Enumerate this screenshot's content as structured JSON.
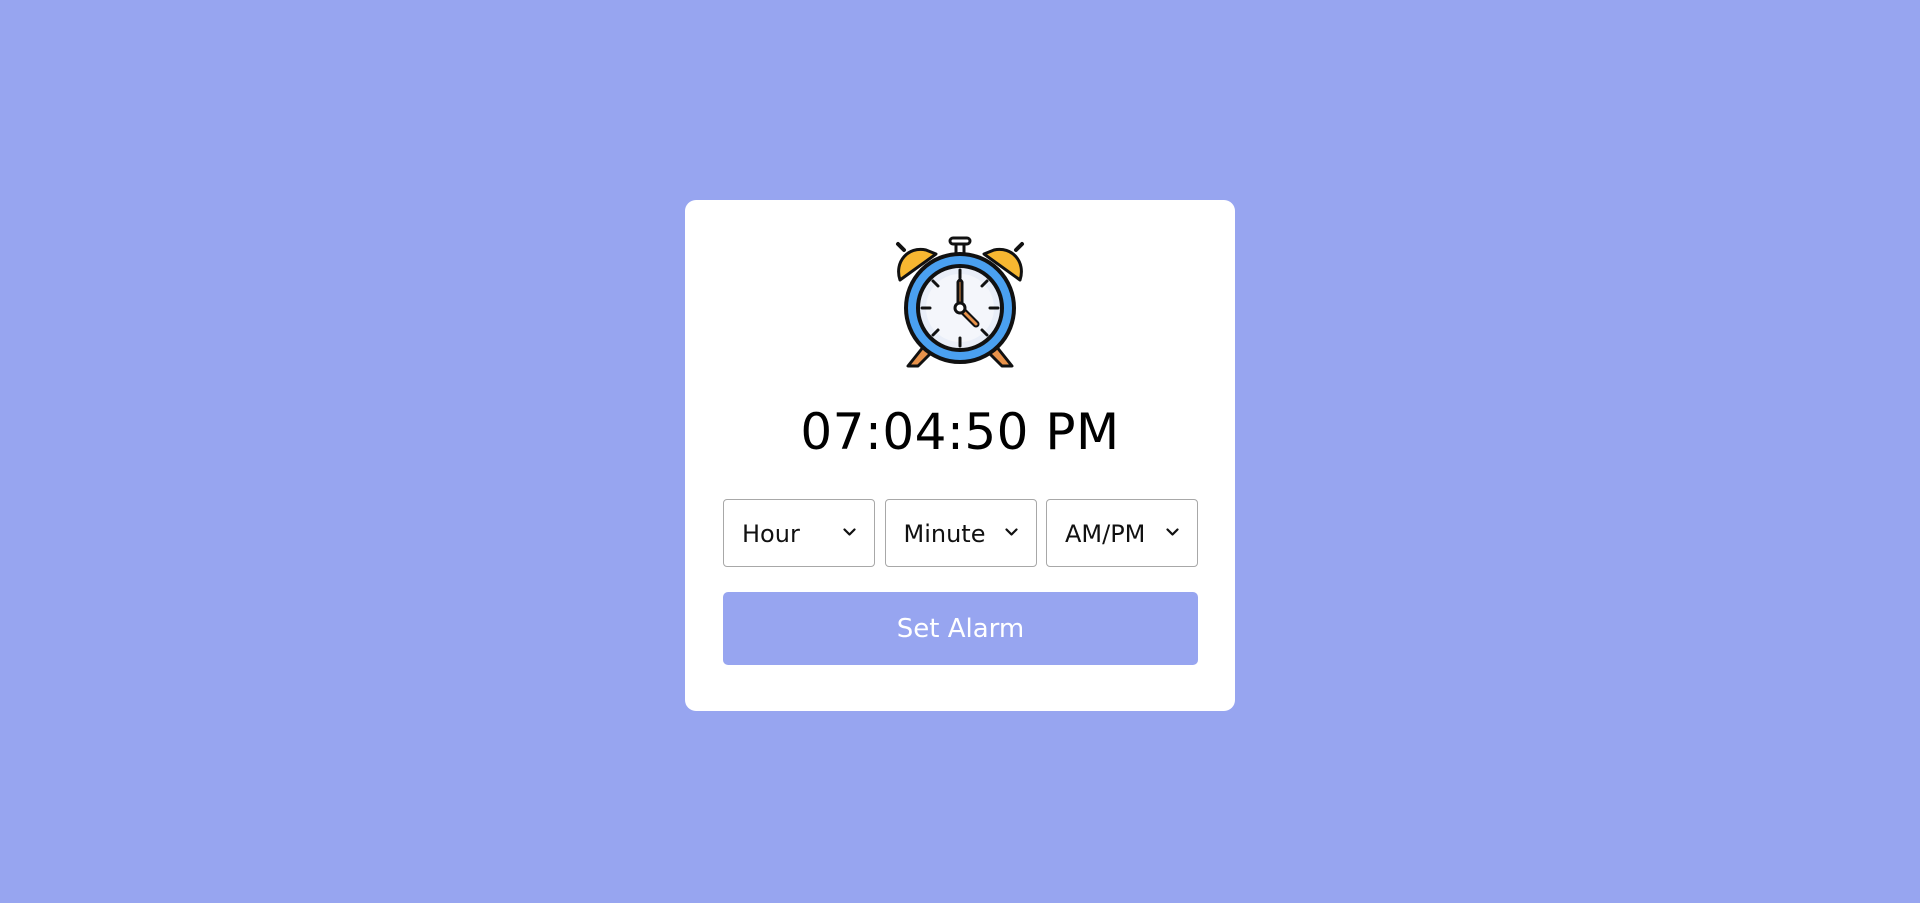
{
  "page": {
    "background_color": "#97a5f0"
  },
  "card": {
    "icon": "alarm-clock-icon",
    "current_time": "07:04:50 PM",
    "selects": {
      "hour": {
        "selected": "Hour"
      },
      "minute": {
        "selected": "Minute"
      },
      "ampm": {
        "selected": "AM/PM"
      }
    },
    "set_button_label": "Set Alarm",
    "accent_color": "#97a5f0"
  }
}
